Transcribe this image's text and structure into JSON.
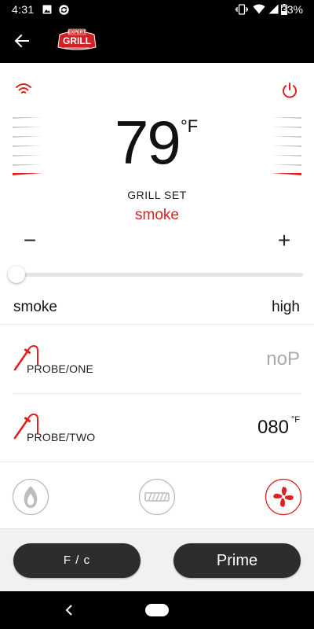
{
  "status_bar": {
    "time": "4:31",
    "battery_percent": "33%",
    "icons": [
      "image-icon",
      "sync-icon",
      "vibrate-icon",
      "wifi-icon",
      "signal-icon",
      "battery-icon"
    ]
  },
  "app_bar": {
    "logo_top_text": "EXPERT",
    "logo_main_text": "GRILL",
    "icons": [
      "back-arrow-icon",
      "brand-logo"
    ]
  },
  "grill": {
    "temperature": "79",
    "unit_symbol": "°F",
    "set_label": "GRILL SET",
    "set_value": "smoke",
    "minus_label": "−",
    "plus_label": "+",
    "slider_level": 0,
    "range_min": "smoke",
    "range_max": "high"
  },
  "probes": [
    {
      "label": "PROBE/ONE",
      "value": "noP",
      "unit": ""
    },
    {
      "label": "PROBE/TWO",
      "value": "080",
      "unit": "°F"
    }
  ],
  "modes": [
    {
      "name": "ignite",
      "icon": "flame-icon",
      "active": false
    },
    {
      "name": "grate",
      "icon": "grate-icon",
      "active": false
    },
    {
      "name": "fan",
      "icon": "fan-icon",
      "active": true
    }
  ],
  "actions": {
    "unit_toggle_label": "F / c",
    "prime_label": "Prime"
  },
  "colors": {
    "accent": "#e02020",
    "button_dark": "#2d2d2d",
    "bar_black": "#000000"
  }
}
